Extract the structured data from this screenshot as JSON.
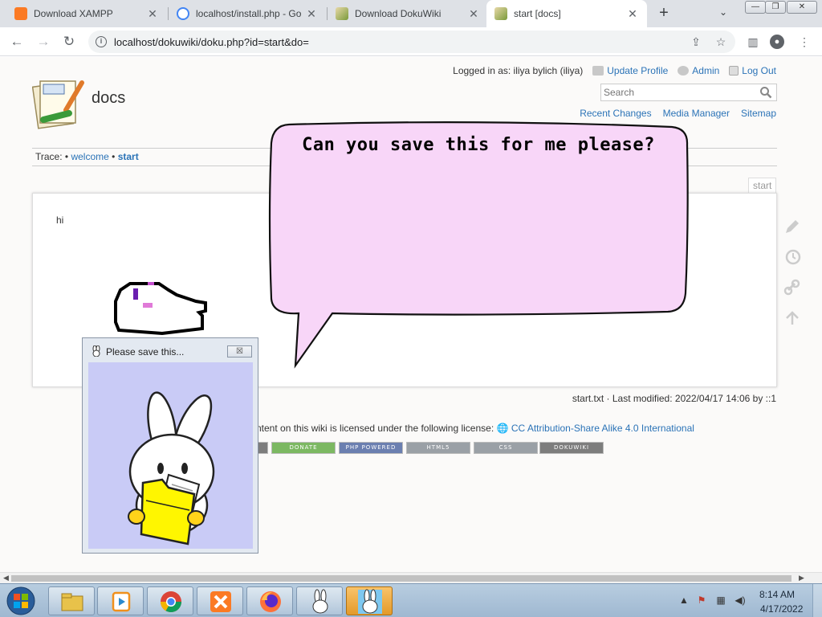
{
  "browser": {
    "tabs": [
      {
        "title": "Download XAMPP",
        "favicon": "xampp-icon",
        "color": "#fb7a24",
        "active": false
      },
      {
        "title": "localhost/install.php - Go",
        "favicon": "google-icon",
        "color": "#4285f4",
        "active": false
      },
      {
        "title": "Download DokuWiki",
        "favicon": "dokuwiki-icon",
        "color": "#7a9a3a",
        "active": false
      },
      {
        "title": "start [docs]",
        "favicon": "dokuwiki-icon",
        "color": "#7a9a3a",
        "active": true
      }
    ],
    "new_tab": "+",
    "url": "localhost/dokuwiki/doku.php?id=start&do="
  },
  "wiki": {
    "title": "docs",
    "user_tools": {
      "logged_in": "Logged in as: iliya bylich (iliya)",
      "update_profile": "Update Profile",
      "admin": "Admin",
      "logout": "Log Out"
    },
    "search": {
      "placeholder": "Search"
    },
    "site_tools": {
      "recent": "Recent Changes",
      "media": "Media Manager",
      "sitemap": "Sitemap"
    },
    "breadcrumbs": {
      "label": "Trace:",
      "sep": "•",
      "items": [
        "welcome",
        "start"
      ]
    },
    "page_id": "start",
    "content": "hi",
    "doc_info": "start.txt · Last modified: 2022/04/17 14:06 by ::1",
    "license_text": "ntent on this wiki is licensed under the following license:",
    "license_link": "CC Attribution-Share Alike 4.0 International",
    "badges": [
      "DONATE",
      "PHP POWERED",
      "HTML5",
      "CSS",
      "DOKUWIKI"
    ]
  },
  "overlay": {
    "speech_bubble": "Can you save this for me please?",
    "popup_title": "Please save this...",
    "popup_close": "☒"
  },
  "taskbar": {
    "time": "8:14 AM",
    "date": "4/17/2022",
    "apps": [
      "explorer-icon",
      "media-player-icon",
      "chrome-icon",
      "xampp-icon",
      "firefox-icon",
      "bunny-icon",
      "bunny-icon"
    ]
  },
  "colors": {
    "link": "#2b73b7",
    "bubble_fill": "#f8d6f8",
    "popup_canvas": "#c9cbf6",
    "taskbar": "#a9c0d8"
  }
}
